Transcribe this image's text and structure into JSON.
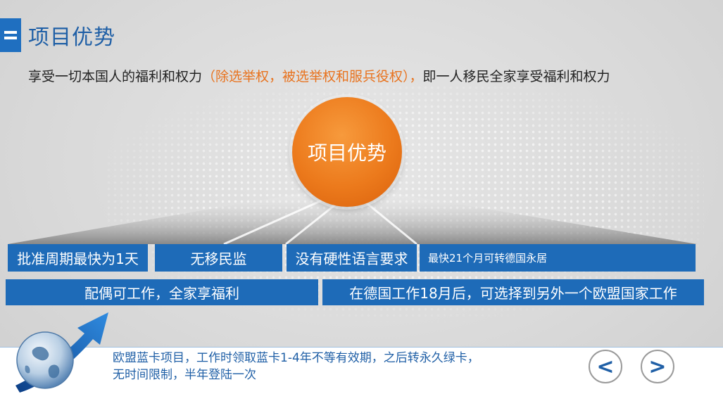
{
  "header": {
    "title": "项目优势",
    "subtitle_part1": "享受一切本国人的福利和权力",
    "subtitle_highlight": "（除选举权，被选举权和服兵役权），",
    "subtitle_part2": "即一人移民全家享受福利和权力"
  },
  "center": {
    "label": "项目优势"
  },
  "benefits": {
    "row1": [
      "批准周期最快为1天",
      "无移民监",
      "没有硬性语言要求",
      "最快21个月可转德国永居"
    ],
    "row2": [
      "配偶可工作，全家享福利",
      "在德国工作18月后，可选择到另外一个欧盟国家工作"
    ]
  },
  "footer": {
    "line1": "欧盟蓝卡项目，工作时领取蓝卡1-4年不等有效期，之后转永久绿卡，",
    "line2": "无时间限制，半年登陆一次",
    "prev_label": "<",
    "next_label": ">"
  },
  "colors": {
    "accent_blue": "#1e6bb8",
    "accent_orange": "#ec7a1c"
  }
}
